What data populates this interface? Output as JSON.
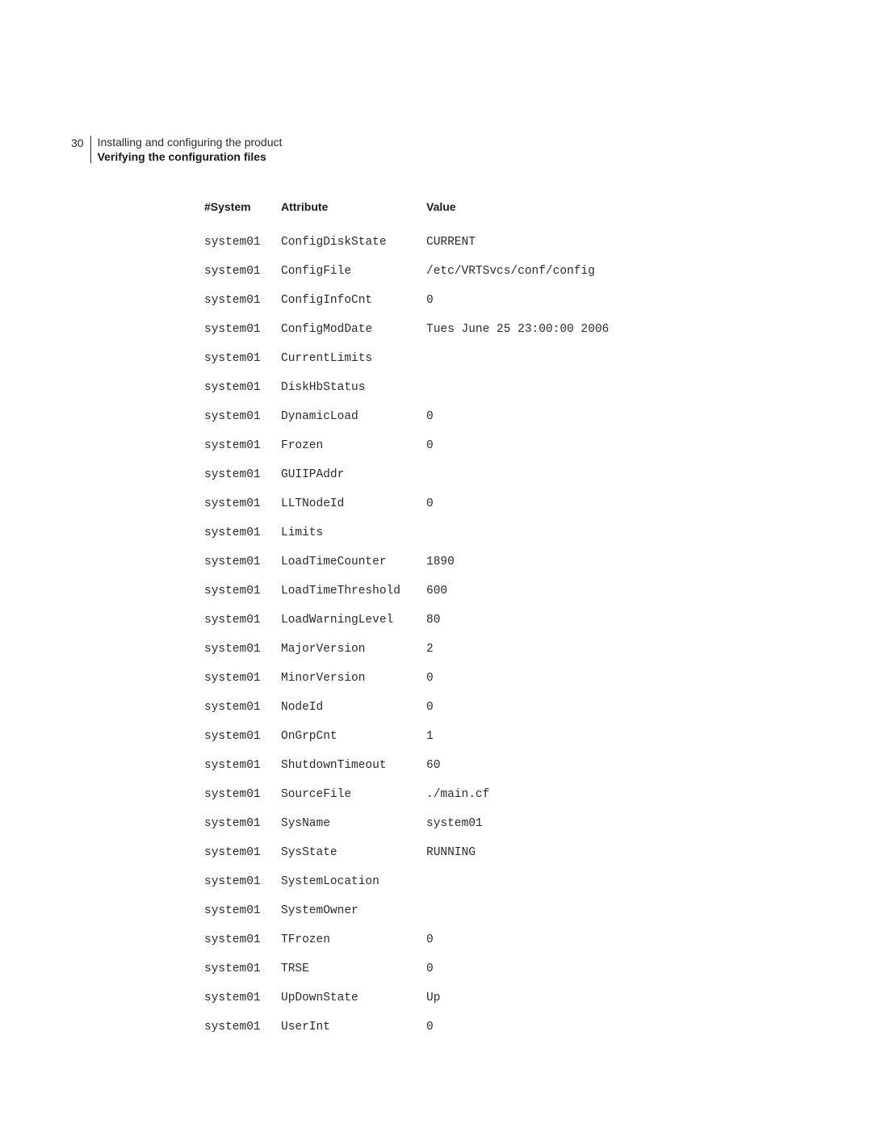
{
  "header": {
    "page_number": "30",
    "line1": "Installing and configuring the product",
    "line2": "Verifying the configuration files"
  },
  "table": {
    "headers": {
      "system": "#System",
      "attribute": "Attribute",
      "value": "Value"
    },
    "rows": [
      {
        "system": "system01",
        "attribute": "ConfigDiskState",
        "value": "CURRENT"
      },
      {
        "system": "system01",
        "attribute": "ConfigFile",
        "value": "/etc/VRTSvcs/conf/config"
      },
      {
        "system": "system01",
        "attribute": "ConfigInfoCnt",
        "value": "0"
      },
      {
        "system": "system01",
        "attribute": "ConfigModDate",
        "value": "Tues June 25 23:00:00 2006"
      },
      {
        "system": "system01",
        "attribute": "CurrentLimits",
        "value": ""
      },
      {
        "system": "system01",
        "attribute": "DiskHbStatus",
        "value": ""
      },
      {
        "system": "system01",
        "attribute": "DynamicLoad",
        "value": "0"
      },
      {
        "system": "system01",
        "attribute": "Frozen",
        "value": "0"
      },
      {
        "system": "system01",
        "attribute": "GUIIPAddr",
        "value": ""
      },
      {
        "system": "system01",
        "attribute": "LLTNodeId",
        "value": "0"
      },
      {
        "system": "system01",
        "attribute": "Limits",
        "value": ""
      },
      {
        "system": "system01",
        "attribute": "LoadTimeCounter",
        "value": "1890"
      },
      {
        "system": "system01",
        "attribute": "LoadTimeThreshold",
        "value": "600"
      },
      {
        "system": "system01",
        "attribute": "LoadWarningLevel",
        "value": "80"
      },
      {
        "system": "system01",
        "attribute": "MajorVersion",
        "value": "2"
      },
      {
        "system": "system01",
        "attribute": "MinorVersion",
        "value": "0"
      },
      {
        "system": "system01",
        "attribute": "NodeId",
        "value": "0"
      },
      {
        "system": "system01",
        "attribute": "OnGrpCnt",
        "value": "1"
      },
      {
        "system": "system01",
        "attribute": "ShutdownTimeout",
        "value": "60"
      },
      {
        "system": "system01",
        "attribute": "SourceFile",
        "value": "./main.cf"
      },
      {
        "system": "system01",
        "attribute": "SysName",
        "value": "system01"
      },
      {
        "system": "system01",
        "attribute": "SysState",
        "value": "RUNNING"
      },
      {
        "system": "system01",
        "attribute": "SystemLocation",
        "value": ""
      },
      {
        "system": "system01",
        "attribute": "SystemOwner",
        "value": ""
      },
      {
        "system": "system01",
        "attribute": "TFrozen",
        "value": "0"
      },
      {
        "system": "system01",
        "attribute": "TRSE",
        "value": "0"
      },
      {
        "system": "system01",
        "attribute": "UpDownState",
        "value": "Up"
      },
      {
        "system": "system01",
        "attribute": "UserInt",
        "value": "0"
      }
    ]
  }
}
